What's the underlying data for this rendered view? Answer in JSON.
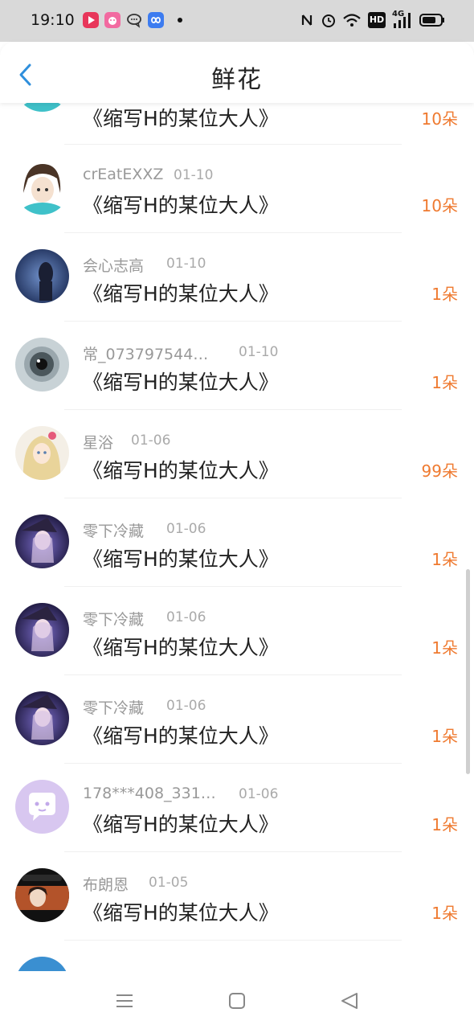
{
  "status_bar": {
    "time": "19:10",
    "icons_left": [
      "video-app-icon",
      "pink-app-icon",
      "chat-app-icon",
      "blue-app-icon",
      "notification-dot"
    ],
    "icons_right": [
      "nfc-icon",
      "alarm-icon",
      "wifi-icon",
      "hd-icon",
      "signal-4g-icon",
      "battery-icon"
    ],
    "network_label": "4G",
    "hd_label": "HD"
  },
  "header": {
    "title": "鲜花",
    "back_icon": "chevron-left-icon",
    "accent_color": "#2f8fdc"
  },
  "list": {
    "items": [
      {
        "user": "",
        "date": "",
        "book": "《缩写H的某位大人》",
        "count": "10朵",
        "avatar": "anime-boy-avatar"
      },
      {
        "user": "crEatEXXZ",
        "date": "01-10",
        "book": "《缩写H的某位大人》",
        "count": "10朵",
        "avatar": "anime-boy-avatar"
      },
      {
        "user": "会心志高",
        "date": "01-10",
        "book": "《缩写H的某位大人》",
        "count": "1朵",
        "avatar": "dark-figure-avatar"
      },
      {
        "user": "常_073797544…",
        "date": "01-10",
        "book": "《缩写H的某位大人》",
        "count": "1朵",
        "avatar": "eye-avatar"
      },
      {
        "user": "星浴",
        "date": "01-06",
        "book": "《缩写H的某位大人》",
        "count": "99朵",
        "avatar": "blonde-girl-avatar"
      },
      {
        "user": "零下冷藏",
        "date": "01-06",
        "book": "《缩写H的某位大人》",
        "count": "1朵",
        "avatar": "witch-girl-avatar"
      },
      {
        "user": "零下冷藏",
        "date": "01-06",
        "book": "《缩写H的某位大人》",
        "count": "1朵",
        "avatar": "witch-girl-avatar"
      },
      {
        "user": "零下冷藏",
        "date": "01-06",
        "book": "《缩写H的某位大人》",
        "count": "1朵",
        "avatar": "witch-girl-avatar"
      },
      {
        "user": "178***408_331…",
        "date": "01-06",
        "book": "《缩写H的某位大人》",
        "count": "1朵",
        "avatar": "default-chat-avatar"
      },
      {
        "user": "布朗恩",
        "date": "01-05",
        "book": "《缩写H的某位大人》",
        "count": "1朵",
        "avatar": "anime-character-avatar"
      },
      {
        "user": "",
        "date": "",
        "book": "",
        "count": "",
        "avatar": "blue-avatar"
      }
    ]
  },
  "nav_bar": {
    "menu_icon": "menu-icon",
    "home_icon": "home-square-icon",
    "back_icon": "back-triangle-icon"
  },
  "colors": {
    "count_orange": "#ef7a30",
    "username_gray": "#999999",
    "status_bar_bg": "#d9d9d9"
  }
}
